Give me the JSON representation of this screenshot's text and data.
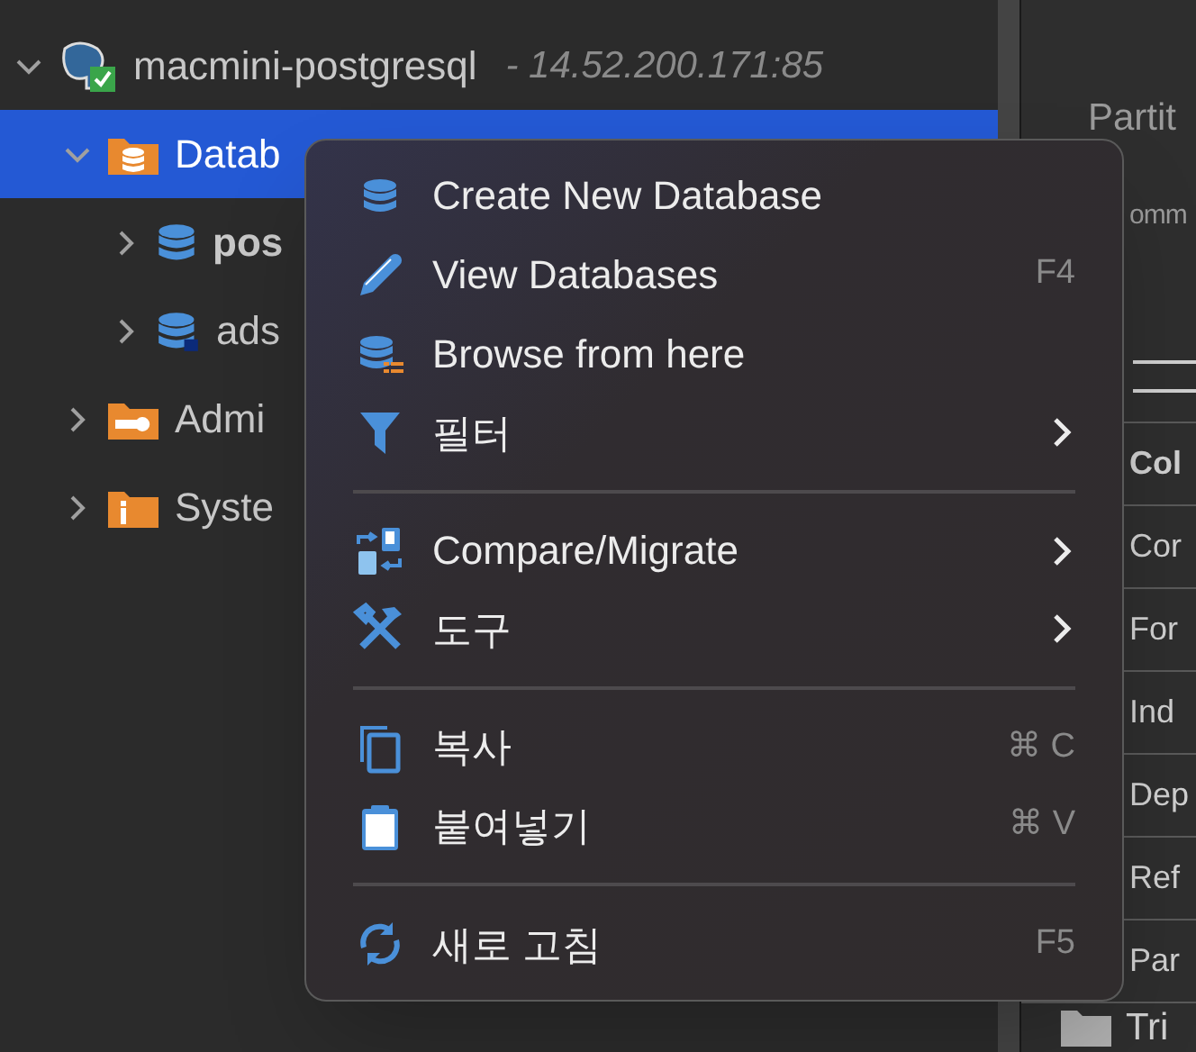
{
  "tree": [
    {
      "label": "macmini-postgresql",
      "detail": "- 14.52.200.171:85",
      "kind": "server",
      "expanded": true,
      "selected": false,
      "bold": false,
      "children": [
        {
          "label": "Datab",
          "kind": "db-folder",
          "expanded": true,
          "selected": true,
          "bold": false,
          "children": [
            {
              "label": "pos",
              "kind": "database",
              "expanded": false,
              "selected": false,
              "bold": true
            },
            {
              "label": "ads",
              "kind": "database-linked",
              "expanded": false,
              "selected": false,
              "bold": false
            }
          ]
        },
        {
          "label": "Admi",
          "kind": "admin-folder",
          "expanded": false,
          "selected": false,
          "bold": false
        },
        {
          "label": "Syste",
          "kind": "info-folder",
          "expanded": false,
          "selected": false,
          "bold": false
        }
      ]
    }
  ],
  "properties": {
    "top_labels": [
      "Partit",
      "omm"
    ],
    "rows": [
      {
        "label": "Col",
        "bold": true
      },
      {
        "label": "Cor",
        "bold": false
      },
      {
        "label": "For",
        "bold": false
      },
      {
        "label": "Ind",
        "bold": false
      },
      {
        "label": "Dep",
        "bold": false
      },
      {
        "label": "Ref",
        "bold": false
      },
      {
        "label": "Par",
        "bold": false
      }
    ],
    "folder": {
      "label": "Tri"
    }
  },
  "context_menu": {
    "items": [
      {
        "kind": "database",
        "label": "Create New Database"
      },
      {
        "kind": "pencil",
        "label": "View Databases",
        "shortcut": "F4"
      },
      {
        "kind": "database-list",
        "label": "Browse from here"
      },
      {
        "kind": "filter",
        "label": "필터",
        "submenu": true
      },
      {
        "kind": "separator"
      },
      {
        "kind": "compare",
        "label": "Compare/Migrate",
        "submenu": true
      },
      {
        "kind": "tools",
        "label": "도구",
        "submenu": true
      },
      {
        "kind": "separator"
      },
      {
        "kind": "copy",
        "label": "복사",
        "shortcut": "⌘ C"
      },
      {
        "kind": "paste",
        "label": "붙여넣기",
        "shortcut": "⌘ V"
      },
      {
        "kind": "separator"
      },
      {
        "kind": "refresh",
        "label": "새로 고침",
        "shortcut": "F5"
      }
    ]
  }
}
